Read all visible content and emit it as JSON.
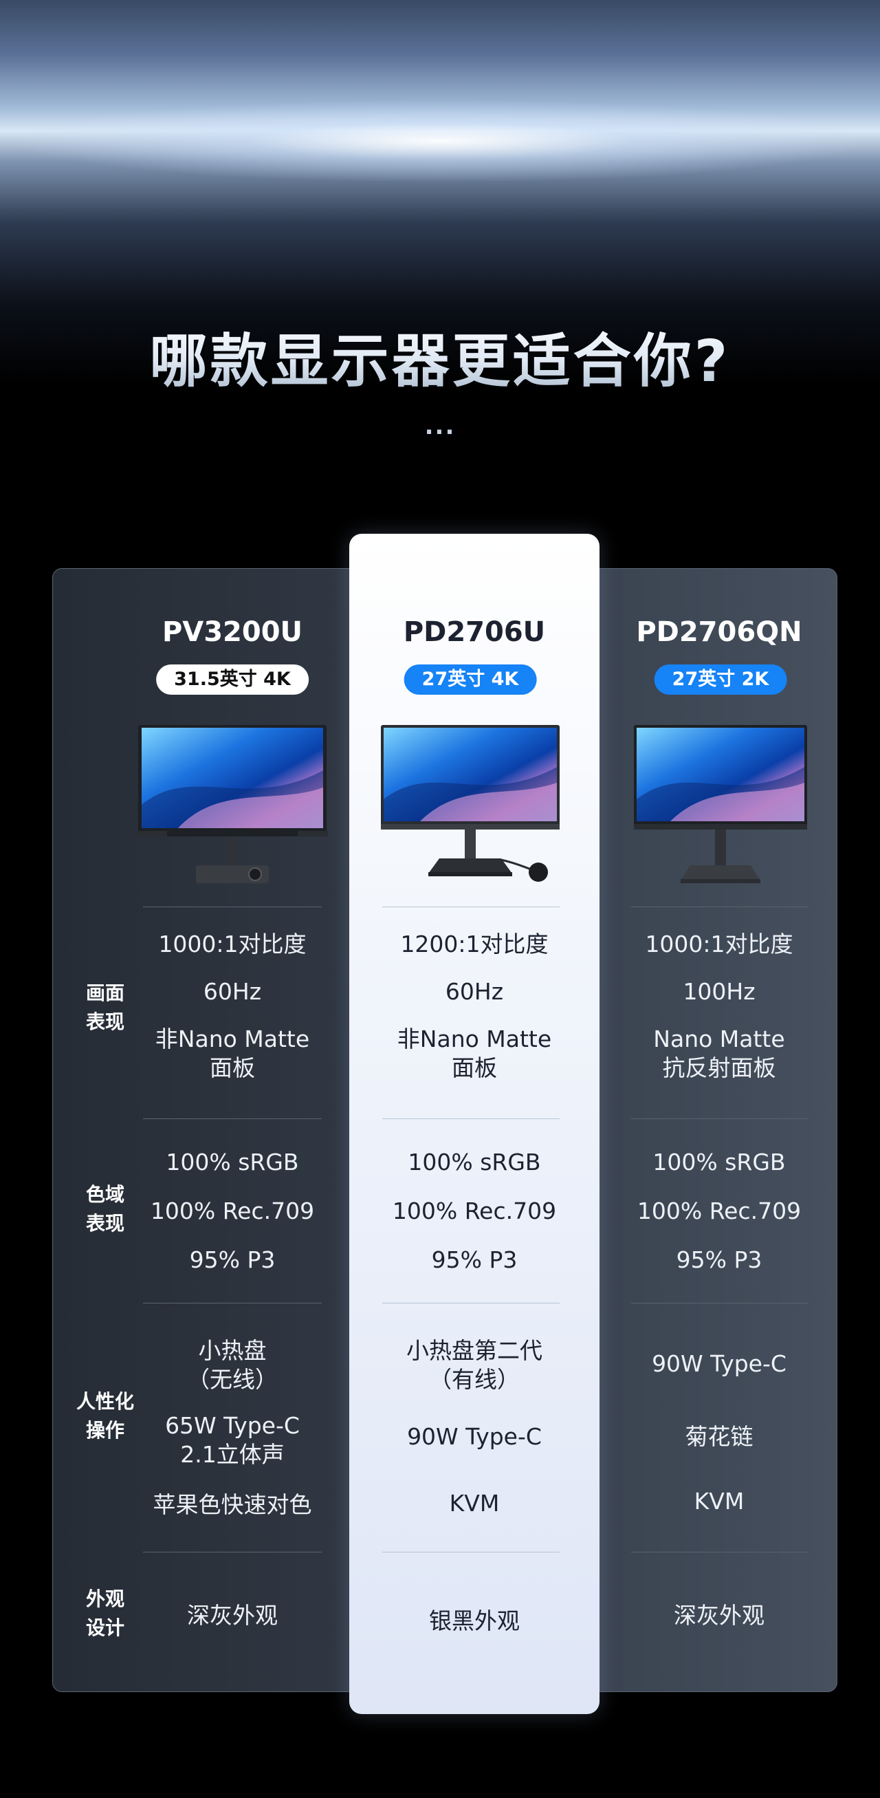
{
  "header": {
    "title": "哪款显示器更适合你?",
    "dots": "..."
  },
  "row_labels": [
    "画面\n表现",
    "色域\n表现",
    "人性化\n操作",
    "外观\n设计"
  ],
  "products": [
    {
      "model": "PV3200U",
      "badge": "31.5英寸 4K",
      "badge_style": "white",
      "image": "monitor-dark-gray-image",
      "display": [
        "1000:1对比度",
        "60Hz",
        "非Nano Matte\n面板"
      ],
      "color": [
        "100% sRGB",
        "100% Rec.709",
        "95% P3"
      ],
      "ergonomics": [
        "小热盘\n（无线）",
        "65W Type-C\n2.1立体声",
        "苹果色快速对色"
      ],
      "design": [
        "深灰外观"
      ]
    },
    {
      "model": "PD2706U",
      "badge": "27英寸 4K",
      "badge_style": "blue",
      "image": "monitor-silver-black-image",
      "display": [
        "1200:1对比度",
        "60Hz",
        "非Nano Matte\n面板"
      ],
      "color": [
        "100% sRGB",
        "100% Rec.709",
        "95% P3"
      ],
      "ergonomics": [
        "小热盘第二代\n（有线）",
        "90W Type-C",
        "KVM"
      ],
      "design": [
        "银黑外观"
      ]
    },
    {
      "model": "PD2706QN",
      "badge": "27英寸 2K",
      "badge_style": "blue",
      "image": "monitor-dark-gray-image",
      "display": [
        "1000:1对比度",
        "100Hz",
        "Nano Matte\n抗反射面板"
      ],
      "color": [
        "100% sRGB",
        "100% Rec.709",
        "95% P3"
      ],
      "ergonomics": [
        "90W Type-C",
        "菊花链",
        "KVM"
      ],
      "design": [
        "深灰外观"
      ]
    }
  ],
  "colors": {
    "accent_blue": "#1683f6",
    "panel_dark": "#2b323c",
    "highlight_light": "#eef2fa"
  }
}
